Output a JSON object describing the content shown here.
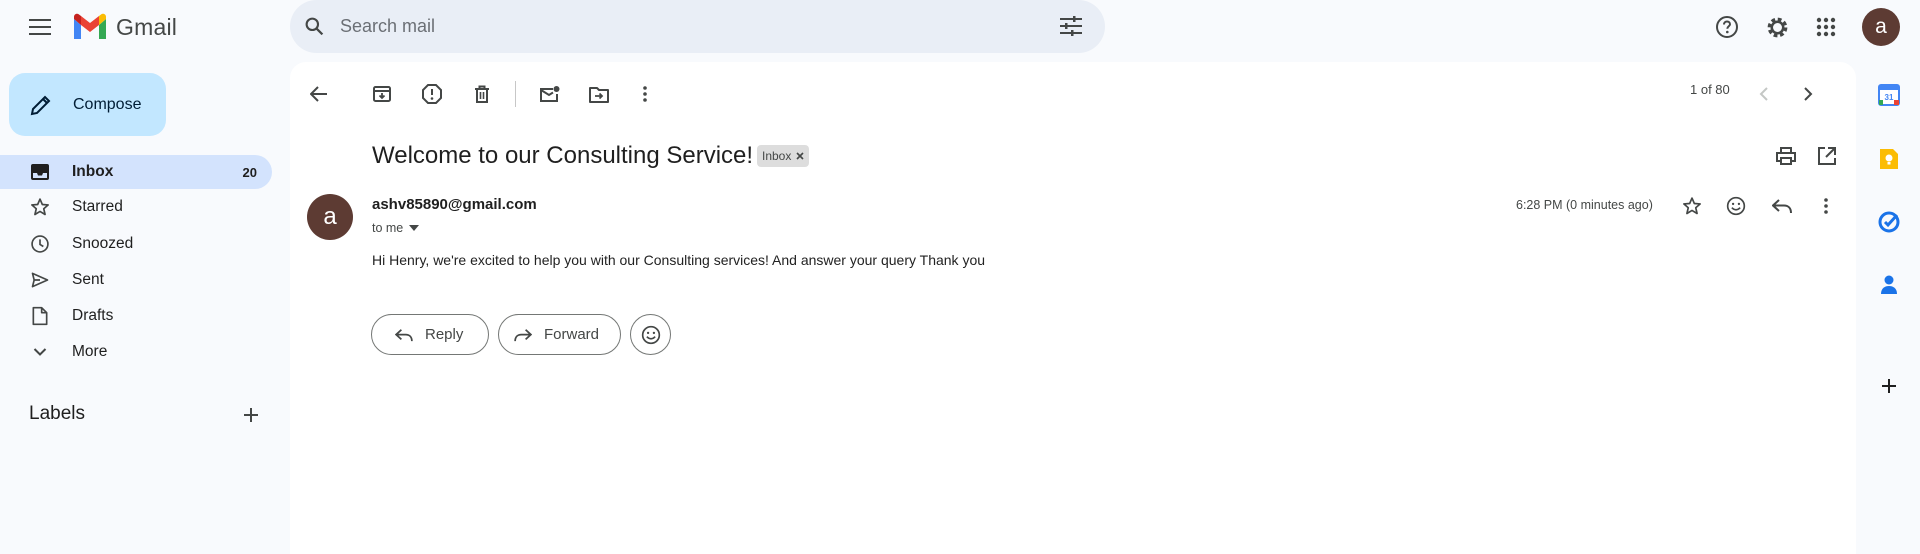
{
  "app": {
    "name": "Gmail"
  },
  "search": {
    "placeholder": "Search mail"
  },
  "account": {
    "initial": "a"
  },
  "sidebar": {
    "compose_label": "Compose",
    "items": [
      {
        "label": "Inbox",
        "count": "20",
        "icon": "inbox-icon"
      },
      {
        "label": "Starred",
        "icon": "star-icon"
      },
      {
        "label": "Snoozed",
        "icon": "clock-icon"
      },
      {
        "label": "Sent",
        "icon": "send-icon"
      },
      {
        "label": "Drafts",
        "icon": "draft-icon"
      },
      {
        "label": "More",
        "icon": "chevron-down-icon"
      }
    ],
    "labels_title": "Labels"
  },
  "toolbar": {
    "pager": "1 of 80"
  },
  "message": {
    "subject": "Welcome to our Consulting Service!",
    "label_chip": "Inbox",
    "sender_initial": "a",
    "sender": "ashv85890@gmail.com",
    "recipient": "to me",
    "time": "6:28 PM (0 minutes ago)",
    "body": "Hi Henry, we're excited to help you with our Consulting services! And answer your query Thank you"
  },
  "actions": {
    "reply": "Reply",
    "forward": "Forward"
  },
  "colors": {
    "accent": "#c2e7ff",
    "active_nav": "#d3e3fd",
    "avatar": "#5d3b33",
    "background": "#f8fafd"
  }
}
